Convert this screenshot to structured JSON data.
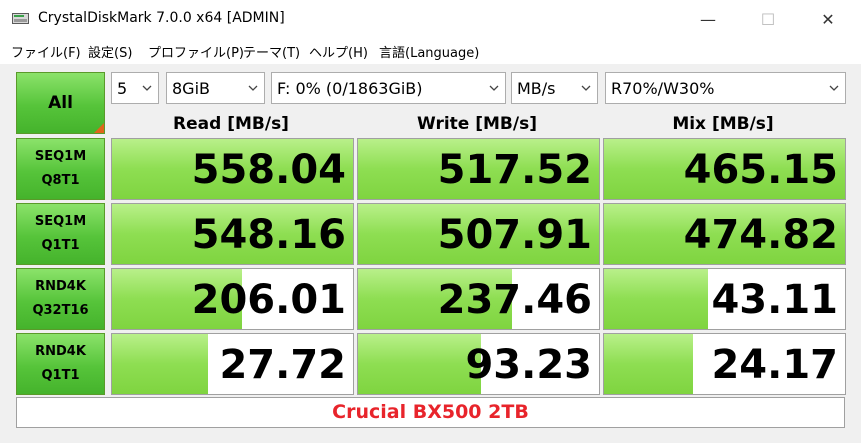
{
  "window": {
    "title": "CrystalDiskMark 7.0.0 x64 [ADMIN]",
    "minimize_glyph": "—",
    "maximize_glyph": "☐",
    "close_glyph": "✕"
  },
  "menu": [
    "ファイル(F)",
    "設定(S)",
    "プロファイル(P)",
    "テーマ(T)",
    "ヘルプ(H)",
    "言語(Language)"
  ],
  "controls": {
    "all_label": "All",
    "count": "5",
    "size": "8GiB",
    "drive": "F: 0% (0/1863GiB)",
    "unit": "MB/s",
    "mix": "R70%/W30%"
  },
  "columns": {
    "read": "Read [MB/s]",
    "write": "Write [MB/s]",
    "mix": "Mix [MB/s]"
  },
  "tests": [
    {
      "line1": "SEQ1M",
      "line2": "Q8T1",
      "read": "558.04",
      "write": "517.52",
      "mix": "465.15",
      "read_fill": 1.0,
      "write_fill": 1.0,
      "mix_fill": 1.0
    },
    {
      "line1": "SEQ1M",
      "line2": "Q1T1",
      "read": "548.16",
      "write": "507.91",
      "mix": "474.82",
      "read_fill": 1.0,
      "write_fill": 1.0,
      "mix_fill": 1.0
    },
    {
      "line1": "RND4K",
      "line2": "Q32T16",
      "read": "206.01",
      "write": "237.46",
      "mix": "43.11",
      "read_fill": 0.54,
      "write_fill": 0.64,
      "mix_fill": 0.43
    },
    {
      "line1": "RND4K",
      "line2": "Q1T1",
      "read": "27.72",
      "write": "93.23",
      "mix": "24.17",
      "read_fill": 0.4,
      "write_fill": 0.51,
      "mix_fill": 0.37
    }
  ],
  "footer_label": "Crucial BX500 2TB",
  "colors": {
    "bar_green": "#8ede52",
    "button_green": "#56c43a",
    "footer_red": "#e8242b",
    "corner_orange": "#e0651b"
  },
  "icons": {
    "app": "disk-icon",
    "dropdown": "chevron-down-icon"
  }
}
